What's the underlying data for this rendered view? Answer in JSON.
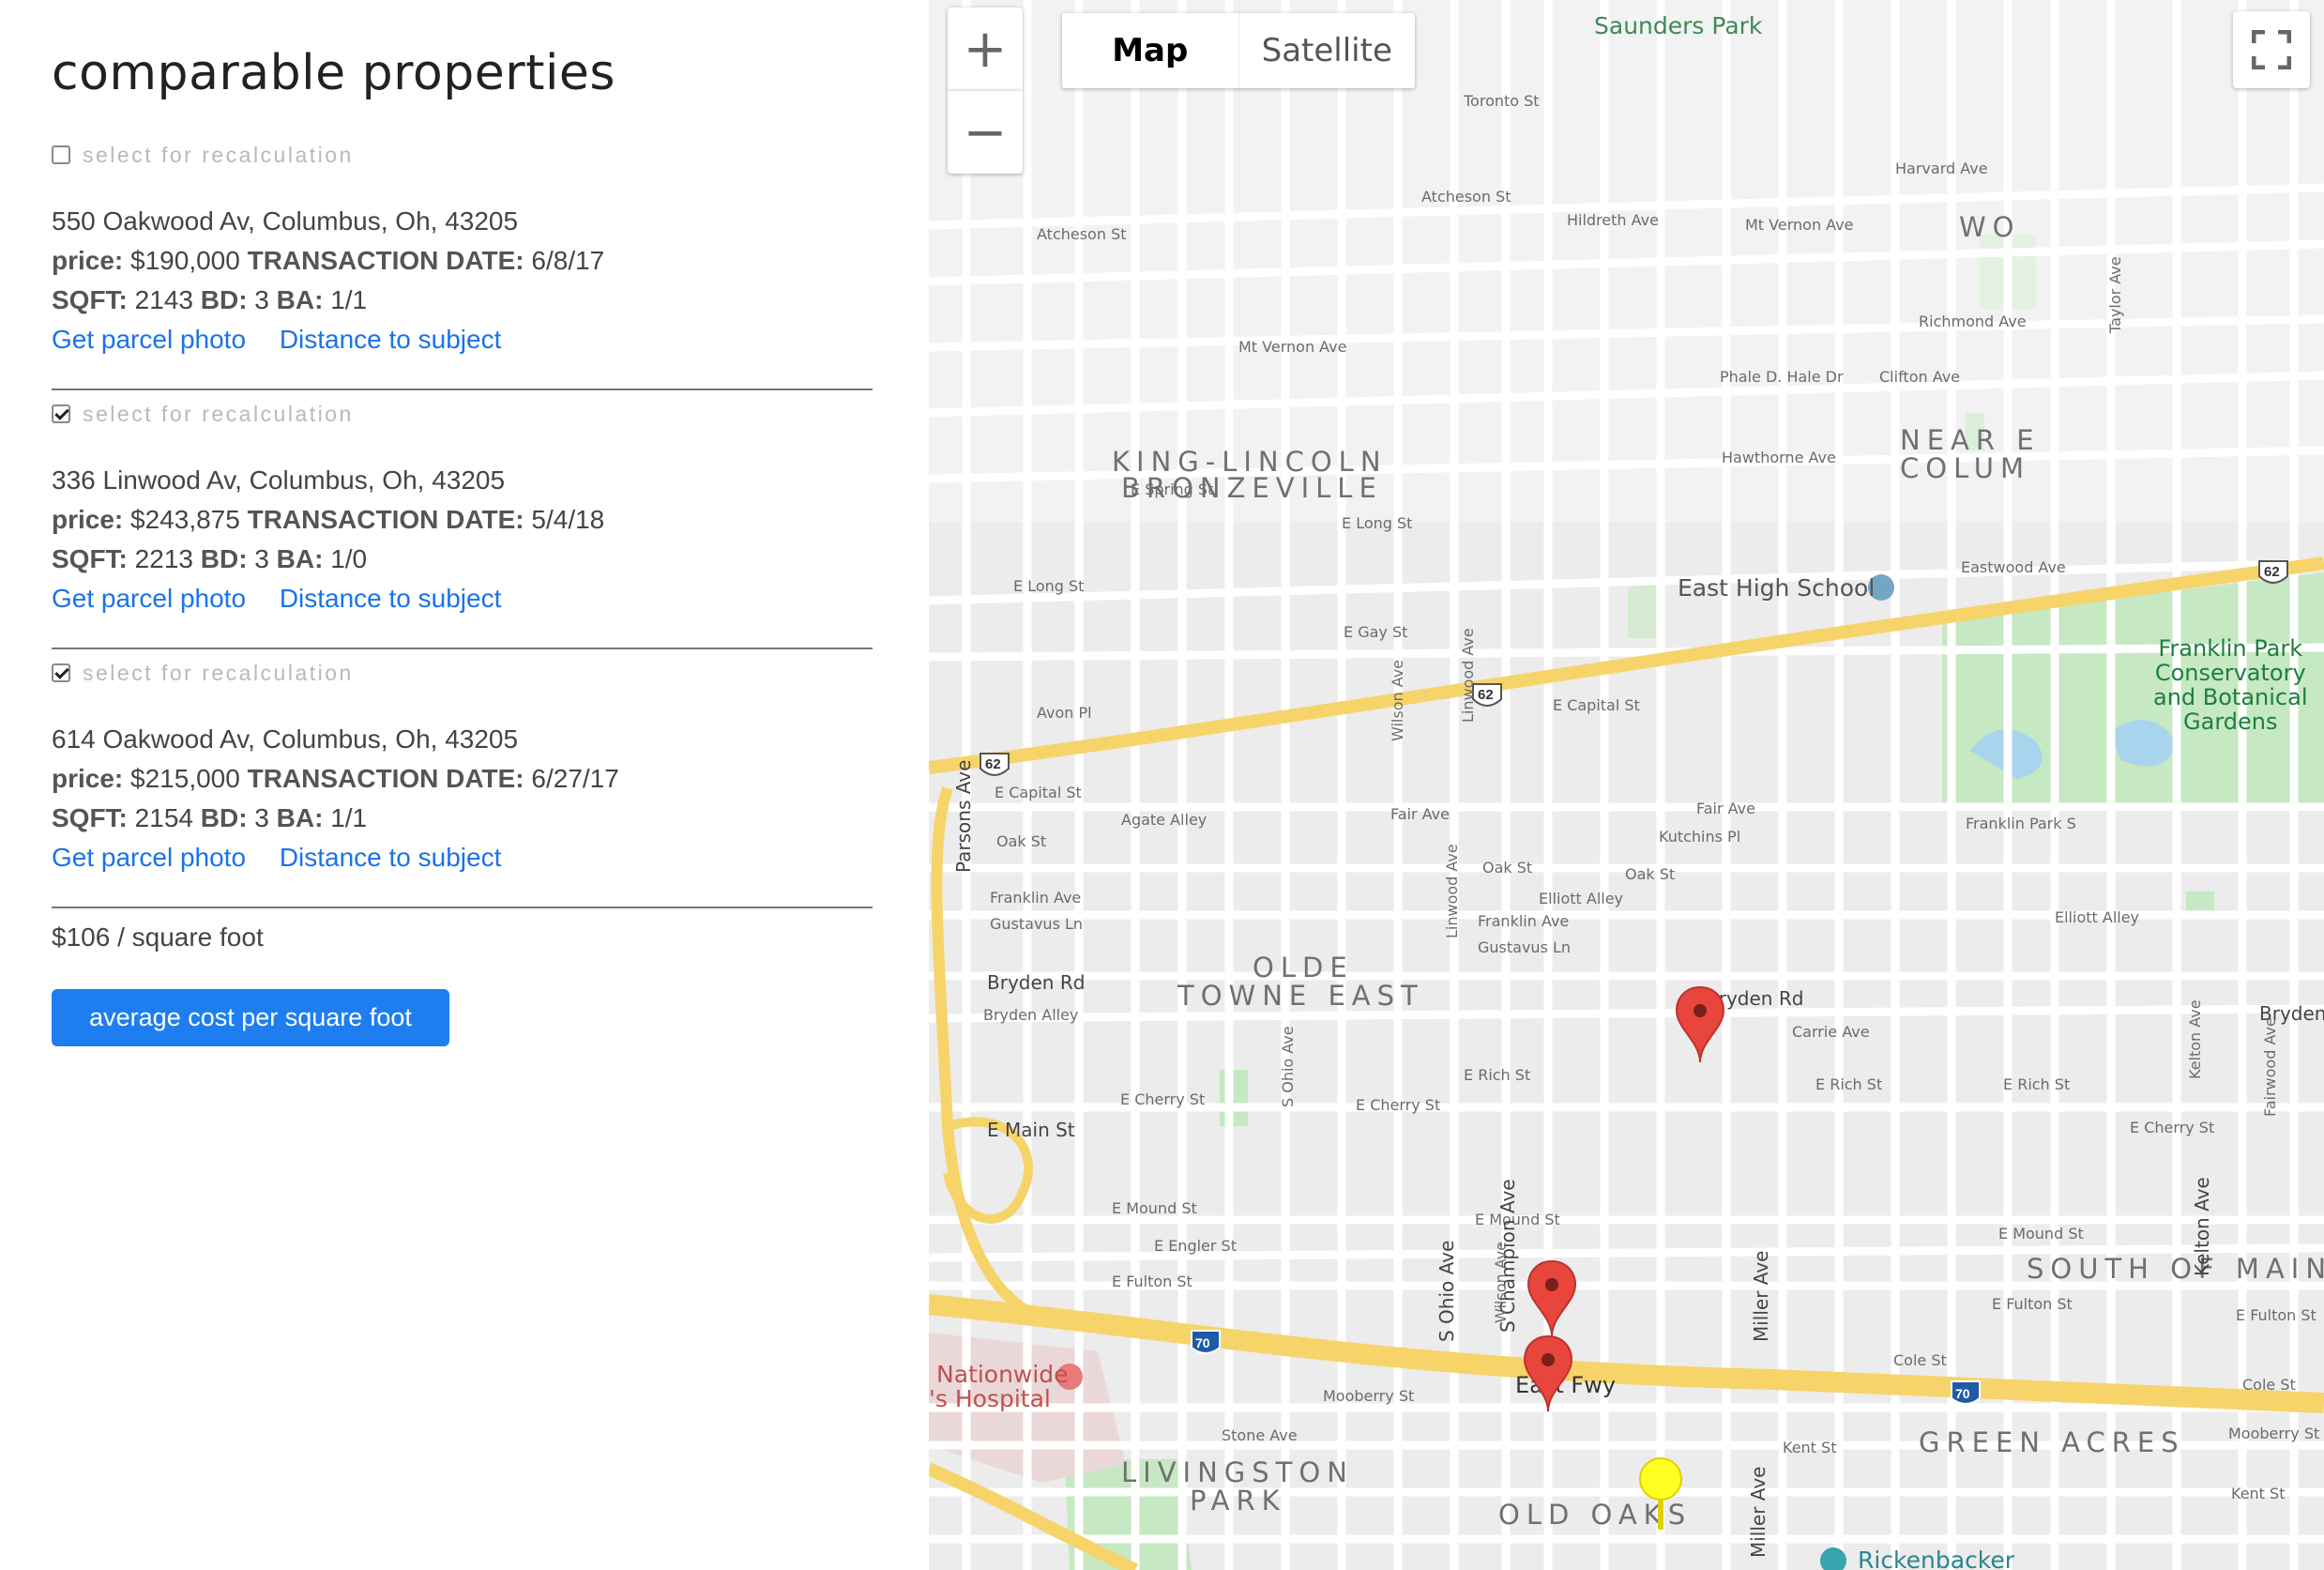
{
  "panel": {
    "title": "comparable properties",
    "select_label": "select for recalculation",
    "properties": [
      {
        "selected": false,
        "address": "550 Oakwood Av, Columbus, Oh, 43205",
        "price_label": "price:",
        "price": "$190,000",
        "date_label": "TRANSACTION DATE:",
        "date": "6/8/17",
        "sqft_label": "SQFT:",
        "sqft": "2143",
        "bd_label": "BD:",
        "bd": "3",
        "ba_label": "BA:",
        "ba": "1/1",
        "photo_link": "Get parcel photo",
        "distance_link": "Distance to subject"
      },
      {
        "selected": true,
        "address": "336 Linwood Av, Columbus, Oh, 43205",
        "price_label": "price:",
        "price": "$243,875",
        "date_label": "TRANSACTION DATE:",
        "date": "5/4/18",
        "sqft_label": "SQFT:",
        "sqft": "2213",
        "bd_label": "BD:",
        "bd": "3",
        "ba_label": "BA:",
        "ba": "1/0",
        "photo_link": "Get parcel photo",
        "distance_link": "Distance to subject"
      },
      {
        "selected": true,
        "address": "614 Oakwood Av, Columbus, Oh, 43205",
        "price_label": "price:",
        "price": "$215,000",
        "date_label": "TRANSACTION DATE:",
        "date": "6/27/17",
        "sqft_label": "SQFT:",
        "sqft": "2154",
        "bd_label": "BD:",
        "bd": "3",
        "ba_label": "BA:",
        "ba": "1/1",
        "photo_link": "Get parcel photo",
        "distance_link": "Distance to subject"
      }
    ],
    "per_sqft": "$106 / square foot",
    "avg_button": "average cost per square foot"
  },
  "map": {
    "zoom_in": "+",
    "zoom_out": "−",
    "type_map": "Map",
    "type_satellite": "Satellite",
    "neighborhoods": {
      "king_lincoln": "KING-LINCOLN",
      "bronzeville": "BRONZEVILLE",
      "olde": "OLDE",
      "towne_east": "TOWNE EAST",
      "south_of_main": "SOUTH OF MAIN",
      "green_acres": "GREEN ACRES",
      "livingston": "LIVINGSTON",
      "park": "PARK",
      "old_oaks": "OLD OAKS",
      "near_e": "NEAR E",
      "colum": "COLUM",
      "wo": "WO"
    },
    "pois": {
      "saunders_park": "Saunders Park",
      "east_high": "East High School",
      "franklin_park": "Franklin Park\nConservatory\nand Botanical\nGardens",
      "nationwide": "Nationwide",
      "hospital": "'s Hospital",
      "rickenbacker": "Rickenbacker",
      "east_fwy": "East Fwy"
    },
    "streets": {
      "e_long": "E Long St",
      "e_gay": "E Gay St",
      "avon": "Avon Pl",
      "e_capital": "E Capital St",
      "agate": "Agate Alley",
      "oak": "Oak St",
      "franklin": "Franklin Ave",
      "gustavus": "Gustavus Ln",
      "bryden": "Bryden Rd",
      "bryden_alley": "Bryden Alley",
      "e_cherry": "E Cherry St",
      "e_main": "E Main St",
      "e_mound": "E Mound St",
      "e_engler": "E Engler St",
      "e_fulton": "E Fulton St",
      "mooberry": "Mooberry St",
      "stone": "Stone Ave",
      "kent": "Kent St",
      "cole": "Cole St",
      "e_rich": "E Rich St",
      "fair": "Fair Ave",
      "kutchins": "Kutchins Pl",
      "elliott": "Elliott Alley",
      "carrie": "Carrie Ave",
      "eastwood": "Eastwood Ave",
      "atcheson": "Atcheson St",
      "mt_vernon": "Mt Vernon Ave",
      "hildreth": "Hildreth Ave",
      "toronto": "Toronto St",
      "harvard": "Harvard Ave",
      "richmond": "Richmond Ave",
      "phale": "Phale D. Hale Dr",
      "clifton": "Clifton Ave",
      "hawthorne": "Hawthorne Ave",
      "e_spring": "E Spring St",
      "franklin_park_s": "Franklin Park S",
      "parsons": "Parsons Ave",
      "champion": "S Champion Ave",
      "ohio": "S Ohio Ave",
      "miller": "Miller Ave",
      "kelton": "Kelton Ave",
      "linwood": "Linwood Ave",
      "wilson": "Wilson Ave",
      "fairwood": "Fairwood Ave",
      "taylor": "Taylor Ave"
    },
    "route_62": "62",
    "route_70": "70"
  }
}
